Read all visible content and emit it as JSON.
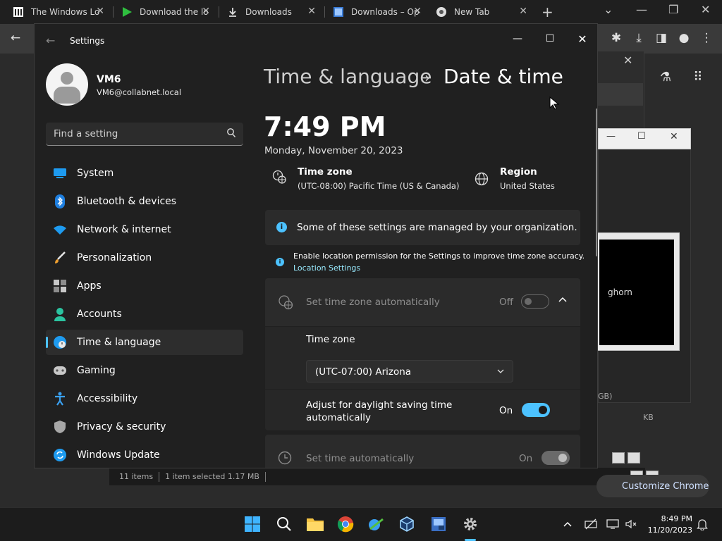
{
  "browser": {
    "tabs": [
      {
        "title": "The Windows Lo"
      },
      {
        "title": "Download the lo"
      },
      {
        "title": "Downloads"
      },
      {
        "title": "Downloads – Op"
      },
      {
        "title": "New Tab"
      }
    ]
  },
  "explorer": {
    "items_count": "11 items",
    "selection": "1 item selected  1.17 MB",
    "customize_chrome": "Customize Chrome",
    "size_fragment": "GB)",
    "kb_fragment": "KB",
    "preview_text": "ghorn"
  },
  "settings": {
    "app_title": "Settings",
    "profile": {
      "name": "VM6",
      "email": "VM6@collabnet.local"
    },
    "search": {
      "placeholder": "Find a setting"
    },
    "nav": [
      {
        "label": "System"
      },
      {
        "label": "Bluetooth & devices"
      },
      {
        "label": "Network & internet"
      },
      {
        "label": "Personalization"
      },
      {
        "label": "Apps"
      },
      {
        "label": "Accounts"
      },
      {
        "label": "Time & language"
      },
      {
        "label": "Gaming"
      },
      {
        "label": "Accessibility"
      },
      {
        "label": "Privacy & security"
      },
      {
        "label": "Windows Update"
      }
    ],
    "breadcrumb": {
      "parent": "Time & language",
      "current": "Date & time"
    },
    "clock": "7:49 PM",
    "date": "Monday, November 20, 2023",
    "timezone": {
      "label": "Time zone",
      "value": "(UTC-08:00) Pacific Time (US & Canada)"
    },
    "region": {
      "label": "Region",
      "value": "United States"
    },
    "info_managed": "Some of these settings are managed by your organization.",
    "info_location": "Enable location permission for the Settings to improve time zone accuracy.",
    "info_location_link": "Location Settings",
    "auto_timezone": {
      "label": "Set time zone automatically",
      "state": "Off"
    },
    "timezone_select": {
      "label": "Time zone",
      "selected": "(UTC-07:00) Arizona"
    },
    "dst": {
      "label": "Adjust for daylight saving time automatically",
      "state": "On"
    },
    "auto_time": {
      "label": "Set time automatically",
      "state": "On"
    }
  },
  "taskbar": {
    "time": "8:49 PM",
    "date": "11/20/2023"
  },
  "colors": {
    "accent": "#4cc2ff",
    "window_bg": "#202020",
    "card_bg": "#2b2b2b"
  }
}
